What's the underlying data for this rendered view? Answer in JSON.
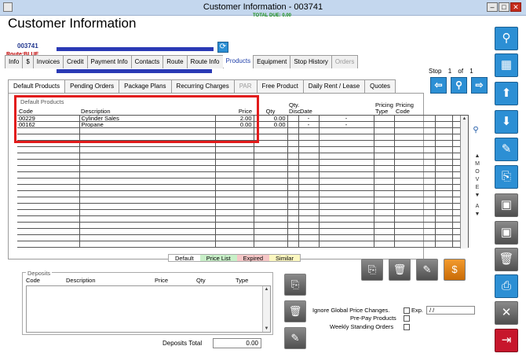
{
  "window": {
    "title": "Customer Information - 003741",
    "total_due_label": "TOTAL DUE:",
    "total_due_value": "0.00"
  },
  "header": {
    "title": "Customer Information",
    "account_number": "003741",
    "route_label": "Route:BLUE"
  },
  "tabs": [
    {
      "label": "Info",
      "state": "normal"
    },
    {
      "label": "$",
      "state": "normal"
    },
    {
      "label": "Invoices",
      "state": "normal"
    },
    {
      "label": "Credit",
      "state": "normal"
    },
    {
      "label": "Payment Info",
      "state": "normal"
    },
    {
      "label": "Contacts",
      "state": "normal"
    },
    {
      "label": "Route",
      "state": "normal"
    },
    {
      "label": "Route Info",
      "state": "normal"
    },
    {
      "label": "Products",
      "state": "active"
    },
    {
      "label": "Equipment",
      "state": "normal"
    },
    {
      "label": "Stop History",
      "state": "normal"
    },
    {
      "label": "Orders",
      "state": "disabled"
    }
  ],
  "stop_nav": {
    "label": "Stop",
    "current": "1",
    "of": "of",
    "total": "1"
  },
  "subtabs": [
    {
      "label": "Default Products",
      "state": "active"
    },
    {
      "label": "Pending Orders",
      "state": "normal"
    },
    {
      "label": "Package Plans",
      "state": "normal"
    },
    {
      "label": "Recurring Charges",
      "state": "normal"
    },
    {
      "label": "PAR",
      "state": "disabled"
    },
    {
      "label": "Free Product",
      "state": "normal"
    },
    {
      "label": "Daily Rent / Lease",
      "state": "normal"
    },
    {
      "label": "Quotes",
      "state": "normal"
    }
  ],
  "products_grid": {
    "group_label": "Default Products",
    "columns": [
      "Code",
      "Description",
      "Price",
      "Qty",
      "Qty.\nDisc.",
      "Date",
      "",
      "Pricing\nType",
      "Pricing\nCode",
      "",
      ""
    ],
    "rows": [
      [
        "00229",
        "Cylinder Sales",
        "2.00",
        "0.00",
        "",
        "-",
        "-",
        "",
        "",
        "",
        ""
      ],
      [
        "00162",
        "Propane",
        "0.00",
        "0.00",
        "",
        "-",
        "-",
        "",
        "",
        "",
        ""
      ]
    ],
    "blank_rows": 19,
    "move_label": "MOVE"
  },
  "legend": [
    {
      "label": "Default",
      "color": "#ffffff"
    },
    {
      "label": "Price List",
      "color": "#c8f0c8"
    },
    {
      "label": "Expired",
      "color": "#f5c6c6"
    },
    {
      "label": "Similar",
      "color": "#fbf7c0"
    }
  ],
  "deposits": {
    "title": "Deposits",
    "columns": [
      "Code",
      "Description",
      "Price",
      "Qty",
      "Type"
    ],
    "total_label": "Deposits Total",
    "total_value": "0.00"
  },
  "options": {
    "ignore_global_label": "Ignore Global Price Changes.",
    "exp_label": "Exp.",
    "exp_value": "/ /",
    "prepay_label": "Pre-Pay Products",
    "weekly_label": "Weekly Standing Orders"
  },
  "icons": {
    "sync": "sync-icon",
    "prev": "arrow-left-icon",
    "search": "search-icon",
    "next": "arrow-right-icon",
    "right_toolbar": [
      "search-icon",
      "grid-icon",
      "arrow-up-icon",
      "arrow-down-icon",
      "pencil-icon",
      "add-document-icon",
      "add-save-icon",
      "save-icon",
      "trash-icon",
      "print-icon",
      "close-icon",
      "exit-icon"
    ]
  }
}
